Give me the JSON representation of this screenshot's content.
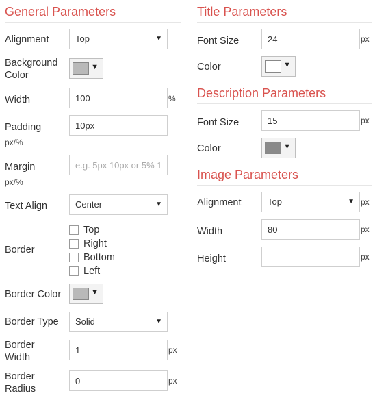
{
  "general": {
    "title": "General Parameters",
    "alignment": {
      "label": "Alignment",
      "value": "Top"
    },
    "background_color": {
      "label_line1": "Background",
      "label_line2": "Color",
      "color": "#b9b9b9"
    },
    "width": {
      "label": "Width",
      "value": "100",
      "unit": "%"
    },
    "padding": {
      "label": "Padding",
      "sublabel": "px/%",
      "value": "10px"
    },
    "margin": {
      "label": "Margin",
      "sublabel": "px/%",
      "placeholder": "e.g. 5px 10px or 5% 10%"
    },
    "text_align": {
      "label": "Text Align",
      "value": "Center"
    },
    "border": {
      "label": "Border",
      "options": [
        {
          "label": "Top",
          "checked": false
        },
        {
          "label": "Right",
          "checked": false
        },
        {
          "label": "Bottom",
          "checked": false
        },
        {
          "label": "Left",
          "checked": false
        }
      ]
    },
    "border_color": {
      "label": "Border Color",
      "color": "#b9b9b9"
    },
    "border_type": {
      "label": "Border Type",
      "value": "Solid"
    },
    "border_width": {
      "label_line1": "Border",
      "label_line2": "Width",
      "value": "1",
      "unit": "px"
    },
    "border_radius": {
      "label_line1": "Border",
      "label_line2": "Radius",
      "value": "0",
      "unit": "px"
    }
  },
  "title_params": {
    "title": "Title Parameters",
    "font_size": {
      "label": "Font Size",
      "value": "24",
      "unit": "px"
    },
    "color": {
      "label": "Color",
      "color": "#ffffff"
    }
  },
  "description_params": {
    "title": "Description Parameters",
    "font_size": {
      "label": "Font Size",
      "value": "15",
      "unit": "px"
    },
    "color": {
      "label": "Color",
      "color": "#8a8a8a"
    }
  },
  "image_params": {
    "title": "Image Parameters",
    "alignment": {
      "label": "Alignment",
      "value": "Top",
      "unit": "px"
    },
    "width": {
      "label": "Width",
      "value": "80",
      "unit": "px"
    },
    "height": {
      "label": "Height",
      "value": "",
      "unit": "px"
    }
  },
  "icons": {
    "dropdown": "caret-down-icon",
    "color_picker": "color-picker-icon",
    "checkbox": "checkbox-icon"
  },
  "colors": {
    "accent": "#d9534f",
    "border": "#cfcfcf",
    "text": "#333333"
  }
}
